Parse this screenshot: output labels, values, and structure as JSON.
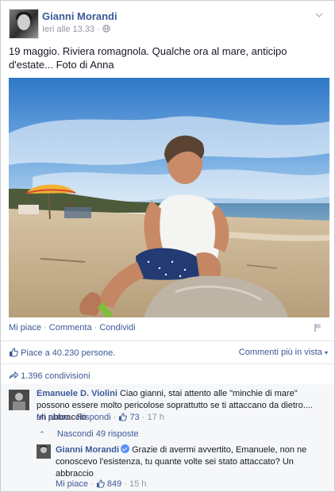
{
  "post": {
    "author": "Gianni Morandi",
    "timestamp": "Ieri alle 13.33",
    "separator": "·",
    "privacy_icon": "globe-icon",
    "text": "19 maggio. Riviera romagnola. Qualche ora al mare, anticipo d'estate... Foto di Anna"
  },
  "actions": {
    "like": "Mi piace",
    "comment": "Commenta",
    "share": "Condividi",
    "dot": "·"
  },
  "stats": {
    "likes": "Piace a 40.230 persone.",
    "relevant": "Commenti più in vista",
    "shares": "1.396 condivisioni"
  },
  "comments": [
    {
      "author": "Emanuele D. Violini",
      "text": "Ciao gianni, stai attento alle \"minchie di mare\" possono essere molto pericolose soprattutto se ti attaccano da dietro.... un abbraccio",
      "like": "Mi piace",
      "reply": "Rispondi",
      "likes": "73",
      "time": "17 h"
    }
  ],
  "hide_replies": "Nascondi 49 risposte",
  "reply": {
    "author": "Gianni Morandi",
    "text": "Grazie di avermi avvertito, Emanuele, non ne conoscevo l'esistenza, tu quante volte sei stato attaccato? Un abbraccio",
    "like": "Mi piace",
    "likes": "849",
    "time": "15 h"
  },
  "colors": {
    "link": "#3b5998",
    "muted": "#9197a3",
    "comment_bg": "#f6f7f9"
  }
}
